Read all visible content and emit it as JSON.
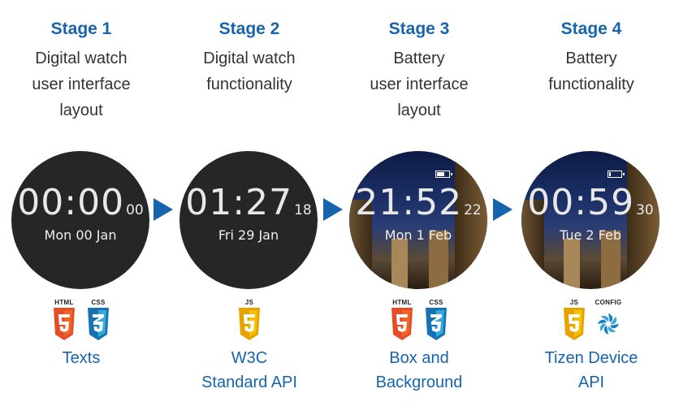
{
  "stages": [
    {
      "title": "Stage 1",
      "desc": [
        "Digital watch",
        "user interface",
        "layout"
      ],
      "watch": {
        "time": "00:00",
        "seconds": "00",
        "date": "Mon 00 Jan",
        "battery_level": null
      },
      "tech": [
        {
          "tag": "HTML",
          "icon": "html5-icon"
        },
        {
          "tag": "CSS",
          "icon": "css3-icon"
        }
      ],
      "label": [
        "Texts"
      ]
    },
    {
      "title": "Stage 2",
      "desc": [
        "Digital watch",
        "functionality"
      ],
      "watch": {
        "time": "01:27",
        "seconds": "18",
        "date": "Fri 29 Jan",
        "battery_level": null
      },
      "tech": [
        {
          "tag": "JS",
          "icon": "javascript-icon"
        }
      ],
      "label": [
        "W3C",
        "Standard API"
      ]
    },
    {
      "title": "Stage 3",
      "desc": [
        "Battery",
        "user interface",
        "layout"
      ],
      "watch": {
        "time": "21:52",
        "seconds": "22",
        "date": "Mon 1 Feb",
        "battery_level": 0.6
      },
      "tech": [
        {
          "tag": "HTML",
          "icon": "html5-icon"
        },
        {
          "tag": "CSS",
          "icon": "css3-icon"
        }
      ],
      "label": [
        "Box and",
        "Background"
      ]
    },
    {
      "title": "Stage 4",
      "desc": [
        "Battery",
        "functionality"
      ],
      "watch": {
        "time": "00:59",
        "seconds": "30",
        "date": "Tue 2 Feb",
        "battery_level": 0.15
      },
      "tech": [
        {
          "tag": "JS",
          "icon": "javascript-icon"
        },
        {
          "tag": "CONFIG",
          "icon": "config-icon"
        }
      ],
      "label": [
        "Tizen Device",
        "API"
      ]
    }
  ],
  "colors": {
    "accent": "#1664ad",
    "html": "#e44d26",
    "css": "#1572b6",
    "js": "#f0b400",
    "config": "#1e7fc0"
  }
}
